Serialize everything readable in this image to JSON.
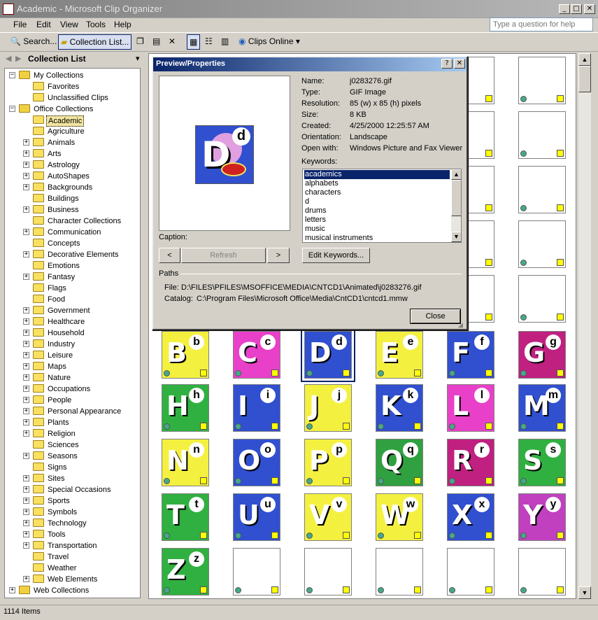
{
  "window": {
    "title": "Academic - Microsoft Clip Organizer",
    "minimize_glyph": "_",
    "maximize_glyph": "□",
    "close_glyph": "✕"
  },
  "menu": [
    "File",
    "Edit",
    "View",
    "Tools",
    "Help"
  ],
  "help_box": {
    "placeholder": "Type a question for help"
  },
  "toolbar": {
    "search_label": "Search...",
    "collection_list_label": "Collection List...",
    "clips_online_label": "Clips Online"
  },
  "left_pane": {
    "title": "Collection List",
    "tree": [
      {
        "label": "My Collections",
        "level": 0,
        "expander": "−"
      },
      {
        "label": "Favorites",
        "level": 1,
        "expander": ""
      },
      {
        "label": "Unclassified Clips",
        "level": 1,
        "expander": ""
      },
      {
        "label": "Office Collections",
        "level": 0,
        "expander": "−"
      },
      {
        "label": "Academic",
        "level": 1,
        "expander": "",
        "selected": true
      },
      {
        "label": "Agriculture",
        "level": 1,
        "expander": ""
      },
      {
        "label": "Animals",
        "level": 1,
        "expander": "+"
      },
      {
        "label": "Arts",
        "level": 1,
        "expander": "+"
      },
      {
        "label": "Astrology",
        "level": 1,
        "expander": "+"
      },
      {
        "label": "AutoShapes",
        "level": 1,
        "expander": "+"
      },
      {
        "label": "Backgrounds",
        "level": 1,
        "expander": "+"
      },
      {
        "label": "Buildings",
        "level": 1,
        "expander": ""
      },
      {
        "label": "Business",
        "level": 1,
        "expander": "+"
      },
      {
        "label": "Character Collections",
        "level": 1,
        "expander": ""
      },
      {
        "label": "Communication",
        "level": 1,
        "expander": "+"
      },
      {
        "label": "Concepts",
        "level": 1,
        "expander": ""
      },
      {
        "label": "Decorative Elements",
        "level": 1,
        "expander": "+"
      },
      {
        "label": "Emotions",
        "level": 1,
        "expander": ""
      },
      {
        "label": "Fantasy",
        "level": 1,
        "expander": "+"
      },
      {
        "label": "Flags",
        "level": 1,
        "expander": ""
      },
      {
        "label": "Food",
        "level": 1,
        "expander": ""
      },
      {
        "label": "Government",
        "level": 1,
        "expander": "+"
      },
      {
        "label": "Healthcare",
        "level": 1,
        "expander": "+"
      },
      {
        "label": "Household",
        "level": 1,
        "expander": "+"
      },
      {
        "label": "Industry",
        "level": 1,
        "expander": "+"
      },
      {
        "label": "Leisure",
        "level": 1,
        "expander": "+"
      },
      {
        "label": "Maps",
        "level": 1,
        "expander": "+"
      },
      {
        "label": "Nature",
        "level": 1,
        "expander": "+"
      },
      {
        "label": "Occupations",
        "level": 1,
        "expander": "+"
      },
      {
        "label": "People",
        "level": 1,
        "expander": "+"
      },
      {
        "label": "Personal Appearance",
        "level": 1,
        "expander": "+"
      },
      {
        "label": "Plants",
        "level": 1,
        "expander": "+"
      },
      {
        "label": "Religion",
        "level": 1,
        "expander": "+"
      },
      {
        "label": "Sciences",
        "level": 1,
        "expander": ""
      },
      {
        "label": "Seasons",
        "level": 1,
        "expander": "+"
      },
      {
        "label": "Signs",
        "level": 1,
        "expander": ""
      },
      {
        "label": "Sites",
        "level": 1,
        "expander": "+"
      },
      {
        "label": "Special Occasions",
        "level": 1,
        "expander": "+"
      },
      {
        "label": "Sports",
        "level": 1,
        "expander": "+"
      },
      {
        "label": "Symbols",
        "level": 1,
        "expander": "+"
      },
      {
        "label": "Technology",
        "level": 1,
        "expander": "+"
      },
      {
        "label": "Tools",
        "level": 1,
        "expander": "+"
      },
      {
        "label": "Transportation",
        "level": 1,
        "expander": "+"
      },
      {
        "label": "Travel",
        "level": 1,
        "expander": ""
      },
      {
        "label": "Weather",
        "level": 1,
        "expander": ""
      },
      {
        "label": "Web Elements",
        "level": 1,
        "expander": "+"
      },
      {
        "label": "Web Collections",
        "level": 0,
        "expander": "+"
      }
    ]
  },
  "clips": [
    {
      "big": "B",
      "small": "b",
      "bg": "#f4f040"
    },
    {
      "big": "C",
      "small": "c",
      "bg": "#e840c8"
    },
    {
      "big": "D",
      "small": "d",
      "bg": "#3050d0",
      "selected": true
    },
    {
      "big": "E",
      "small": "e",
      "bg": "#f4f040"
    },
    {
      "big": "F",
      "small": "f",
      "bg": "#3050d0"
    },
    {
      "big": "G",
      "small": "g",
      "bg": "#c02080"
    },
    {
      "big": "H",
      "small": "h",
      "bg": "#30b040"
    },
    {
      "big": "I",
      "small": "i",
      "bg": "#3050d0"
    },
    {
      "big": "J",
      "small": "j",
      "bg": "#f4f040"
    },
    {
      "big": "K",
      "small": "k",
      "bg": "#3050d0"
    },
    {
      "big": "L",
      "small": "l",
      "bg": "#e840c8"
    },
    {
      "big": "M",
      "small": "m",
      "bg": "#3050d0"
    },
    {
      "big": "N",
      "small": "n",
      "bg": "#f4f040"
    },
    {
      "big": "O",
      "small": "o",
      "bg": "#3050d0"
    },
    {
      "big": "P",
      "small": "p",
      "bg": "#f4f040"
    },
    {
      "big": "Q",
      "small": "q",
      "bg": "#30a040"
    },
    {
      "big": "R",
      "small": "r",
      "bg": "#c02080"
    },
    {
      "big": "S",
      "small": "s",
      "bg": "#30b040"
    },
    {
      "big": "T",
      "small": "t",
      "bg": "#30b040"
    },
    {
      "big": "U",
      "small": "u",
      "bg": "#3050d0"
    },
    {
      "big": "V",
      "small": "v",
      "bg": "#f4f040"
    },
    {
      "big": "W",
      "small": "w",
      "bg": "#f4f040"
    },
    {
      "big": "X",
      "small": "x",
      "bg": "#3050d0"
    },
    {
      "big": "Y",
      "small": "y",
      "bg": "#c040c0"
    },
    {
      "big": "Z",
      "small": "z",
      "bg": "#30b040"
    },
    {
      "big": "",
      "small": "",
      "bg": "#ffffff"
    },
    {
      "big": "",
      "small": "",
      "bg": "#ffffff"
    },
    {
      "big": "",
      "small": "",
      "bg": "#ffffff"
    },
    {
      "big": "",
      "small": "",
      "bg": "#ffffff"
    },
    {
      "big": "",
      "small": "",
      "bg": "#ffffff"
    }
  ],
  "dialog": {
    "title": "Preview/Properties",
    "help_glyph": "?",
    "close_glyph": "✕",
    "preview_letters": {
      "big": "D",
      "small": "d"
    },
    "properties": [
      {
        "label": "Name:",
        "value": "j0283276.gif"
      },
      {
        "label": "Type:",
        "value": "GIF Image"
      },
      {
        "label": "Resolution:",
        "value": "85 (w) x 85 (h) pixels"
      },
      {
        "label": "Size:",
        "value": "8 KB"
      },
      {
        "label": "Created:",
        "value": "4/25/2000 12:25:57 AM"
      },
      {
        "label": "Orientation:",
        "value": "Landscape"
      },
      {
        "label": "Open with:",
        "value": "Windows Picture and Fax Viewer"
      }
    ],
    "keywords_label": "Keywords:",
    "keywords": [
      "academics",
      "alphabets",
      "characters",
      "d",
      "drums",
      "letters",
      "music",
      "musical instruments"
    ],
    "caption_label": "Caption:",
    "prev_label": "<",
    "refresh_label": "Refresh",
    "next_label": ">",
    "edit_keywords_label": "Edit Keywords...",
    "paths_label": "Paths",
    "file_label": "File:",
    "file_path": "D:\\FILES\\PFILES\\MSOFFICE\\MEDIA\\CNTCD1\\Animated\\j0283276.gif",
    "catalog_label": "Catalog:",
    "catalog_path": "C:\\Program Files\\Microsoft Office\\Media\\CntCD1\\cntcd1.mmw",
    "close_label": "Close"
  },
  "status": {
    "text": "1114 Items"
  }
}
